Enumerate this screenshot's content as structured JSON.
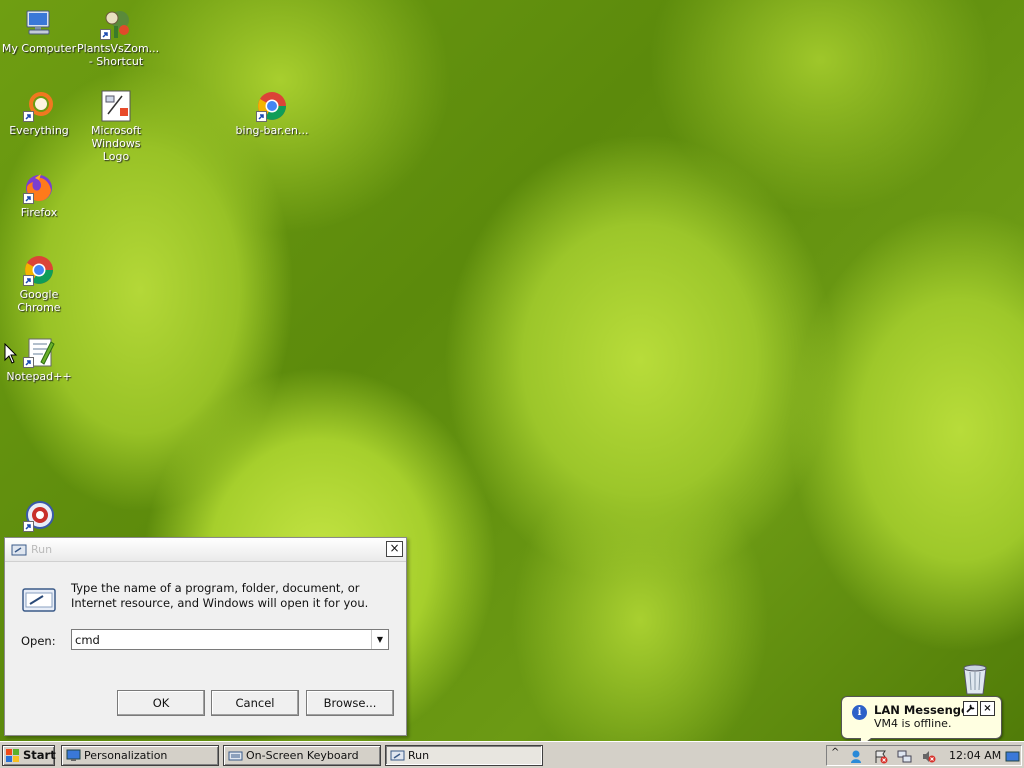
{
  "desktop": {
    "icons": [
      {
        "name": "my-computer",
        "label": "My Computer"
      },
      {
        "name": "plants-vs-zombies",
        "label": "PlantsVsZom... - Shortcut"
      },
      {
        "name": "everything",
        "label": "Everything"
      },
      {
        "name": "microsoft-windows-logo",
        "label": "Microsoft Windows Logo"
      },
      {
        "name": "bing-bar",
        "label": "bing-bar.en..."
      },
      {
        "name": "firefox",
        "label": "Firefox"
      },
      {
        "name": "google-chrome",
        "label": "Google Chrome"
      },
      {
        "name": "notepad-plus-plus",
        "label": "Notepad++"
      }
    ]
  },
  "run_dialog": {
    "title": "Run",
    "description": "Type the name of a program, folder, document, or Internet resource, and Windows will open it for you.",
    "open_label": "Open:",
    "open_value": "cmd",
    "ok_label": "OK",
    "cancel_label": "Cancel",
    "browse_label": "Browse...",
    "close_glyph": "×"
  },
  "balloon": {
    "title": "LAN Messenger",
    "message": "VM4 is offline.",
    "info_glyph": "i",
    "tool_glyph": "🔧",
    "close_glyph": "×"
  },
  "taskbar": {
    "start_label": "Start",
    "buttons": [
      {
        "label": "Personalization"
      },
      {
        "label": "On-Screen Keyboard"
      },
      {
        "label": "Run"
      }
    ],
    "tray": {
      "clock": "12:04 AM",
      "expand_glyph": "^"
    }
  },
  "colors": {
    "wallpaper": "#8fbc1f",
    "taskbar": "#d4d0c8",
    "dialog": "#f0f0f0",
    "balloon": "#ffffe1"
  }
}
